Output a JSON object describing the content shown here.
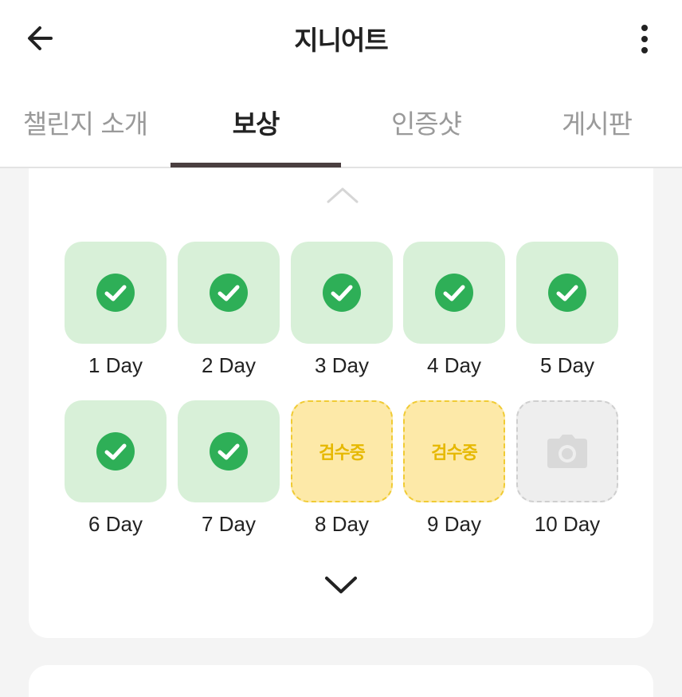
{
  "header": {
    "title": "지니어트",
    "back_icon": "arrow-left-icon",
    "menu_icon": "more-vertical-icon"
  },
  "tabs": [
    {
      "label": "챌린지 소개",
      "active": false
    },
    {
      "label": "보상",
      "active": true
    },
    {
      "label": "인증샷",
      "active": false
    },
    {
      "label": "게시판",
      "active": false
    }
  ],
  "days": [
    {
      "label": "1 Day",
      "status": "done"
    },
    {
      "label": "2 Day",
      "status": "done"
    },
    {
      "label": "3 Day",
      "status": "done"
    },
    {
      "label": "4 Day",
      "status": "done"
    },
    {
      "label": "5 Day",
      "status": "done"
    },
    {
      "label": "6 Day",
      "status": "done"
    },
    {
      "label": "7 Day",
      "status": "done"
    },
    {
      "label": "8 Day",
      "status": "review",
      "text": "검수중"
    },
    {
      "label": "9 Day",
      "status": "review",
      "text": "검수중"
    },
    {
      "label": "10 Day",
      "status": "empty",
      "icon": "camera-icon"
    }
  ],
  "colors": {
    "done_bg": "#d8f0d8",
    "check_circle": "#2eaf57",
    "review_bg": "#fde9a8",
    "review_text": "#e6b800",
    "empty_bg": "#eeeeee",
    "tab_indicator": "#4a3f40"
  }
}
